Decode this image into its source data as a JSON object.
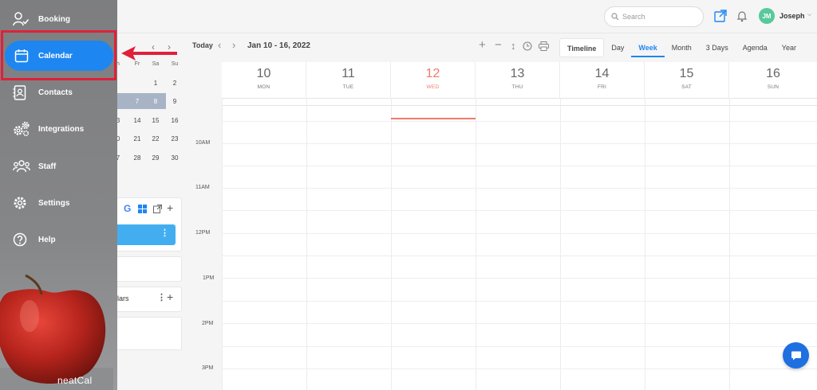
{
  "header": {
    "search_placeholder": "Search",
    "avatar_initials": "JM",
    "user_name": "Joseph"
  },
  "sidebar": {
    "items": [
      {
        "label": "Booking",
        "icon": "user-check-icon"
      },
      {
        "label": "Calendar",
        "icon": "calendar-icon",
        "active": true
      },
      {
        "label": "Contacts",
        "icon": "contacts-icon"
      },
      {
        "label": "Integrations",
        "icon": "gears-icon"
      },
      {
        "label": "Staff",
        "icon": "users-icon"
      },
      {
        "label": "Settings",
        "icon": "gear-icon"
      },
      {
        "label": "Help",
        "icon": "help-icon"
      }
    ],
    "brand": "neatCal",
    "accent": "#1e86f0",
    "highlight_color": "#e0203a"
  },
  "mini_calendar": {
    "weekday_headers": [
      "h",
      "Fr",
      "Sa",
      "Su"
    ],
    "rows": [
      [
        "",
        "",
        "1",
        "2"
      ],
      [
        "",
        "7",
        "8",
        "9"
      ],
      [
        "3",
        "14",
        "15",
        "16"
      ],
      [
        "0",
        "21",
        "22",
        "23"
      ],
      [
        "7",
        "28",
        "29",
        "30"
      ]
    ]
  },
  "panels": {
    "calendars_label": "lars"
  },
  "toolbar": {
    "today": "Today",
    "range": "Jan 10 - 16, 2022",
    "views": [
      "Timeline",
      "Day",
      "Week",
      "Month",
      "3 Days",
      "Agenda",
      "Year"
    ],
    "active_view": "Week"
  },
  "week": {
    "days": [
      {
        "num": "10",
        "name": "MON"
      },
      {
        "num": "11",
        "name": "TUE"
      },
      {
        "num": "12",
        "name": "WED",
        "today": true
      },
      {
        "num": "13",
        "name": "THU"
      },
      {
        "num": "14",
        "name": "FRI"
      },
      {
        "num": "15",
        "name": "SAT"
      },
      {
        "num": "16",
        "name": "SUN"
      }
    ],
    "today_color": "#f07a6a",
    "time_labels": [
      "10AM",
      "11AM",
      "12PM",
      "1PM",
      "2PM",
      "3PM"
    ]
  }
}
